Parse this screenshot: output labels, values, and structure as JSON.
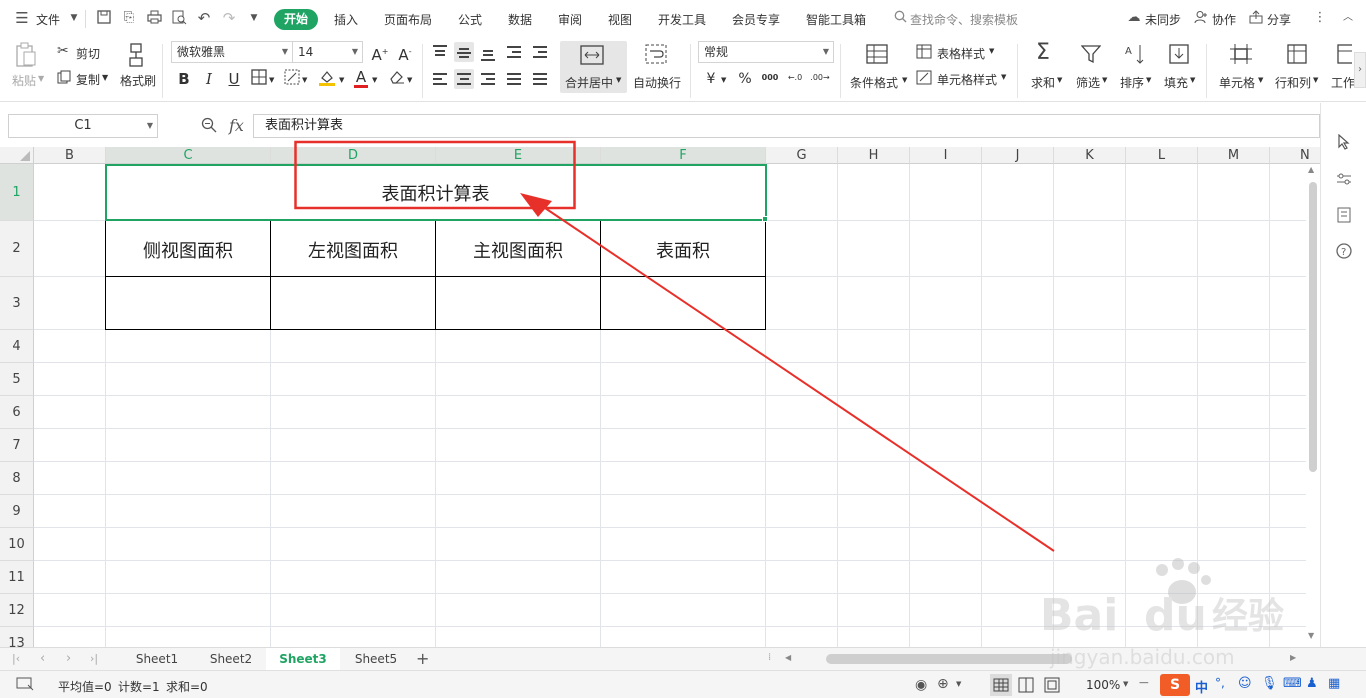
{
  "menubar": {
    "file": "文件",
    "tabs": [
      "开始",
      "插入",
      "页面布局",
      "公式",
      "数据",
      "审阅",
      "视图",
      "开发工具",
      "会员专享",
      "智能工具箱"
    ],
    "search_placeholder": "查找命令、搜索模板",
    "sync": "未同步",
    "collab": "协作",
    "share": "分享"
  },
  "ribbon": {
    "paste": "粘贴",
    "cut": "剪切",
    "copy": "复制",
    "format_painter": "格式刷",
    "font_name": "微软雅黑",
    "font_size": "14",
    "merge_center": "合并居中",
    "wrap_text": "自动换行",
    "number_format": "常规",
    "conditional_format": "条件格式",
    "table_style": "表格样式",
    "cell_style": "单元格样式",
    "sum": "求和",
    "filter": "筛选",
    "sort": "排序",
    "fill": "填充",
    "cell": "单元格",
    "row_col": "行和列",
    "worksheet": "工作",
    "currency_symbol": "¥",
    "percent_symbol": "%",
    "thousands_symbol": "000",
    "inc_decimal": "←.0",
    "dec_decimal": ".00→"
  },
  "formula_bar": {
    "name_box": "C1",
    "fx": "fx",
    "content": "表面积计算表"
  },
  "sheet": {
    "columns": [
      "B",
      "C",
      "D",
      "E",
      "F",
      "G",
      "H",
      "I",
      "J",
      "K",
      "L",
      "M",
      "N"
    ],
    "rows": [
      "1",
      "2",
      "3",
      "4",
      "5",
      "6",
      "7",
      "8",
      "9",
      "10",
      "11",
      "12",
      "13"
    ],
    "title": "表面积计算表",
    "headers": [
      "侧视图面积",
      "左视图面积",
      "主视图面积",
      "表面积"
    ]
  },
  "sheet_tabs": [
    "Sheet1",
    "Sheet2",
    "Sheet3",
    "Sheet5"
  ],
  "active_sheet": "Sheet3",
  "status": {
    "average": "平均值=0",
    "count": "计数=1",
    "sum": "求和=0",
    "zoom": "100%"
  },
  "ime": {
    "lang": "中"
  },
  "colors": {
    "accent": "#1fa463",
    "annotation": "#e8302a"
  }
}
